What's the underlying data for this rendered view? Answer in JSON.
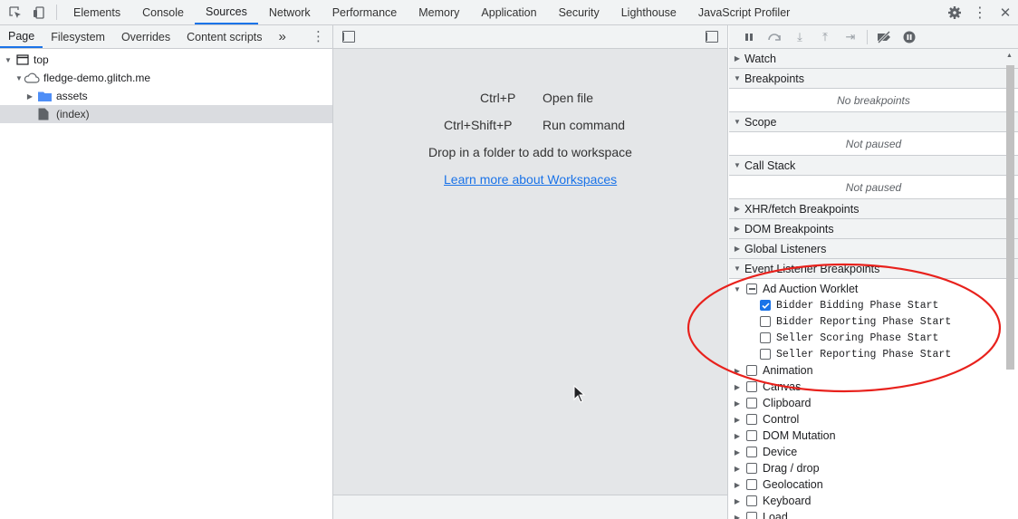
{
  "tabs": [
    "Elements",
    "Console",
    "Sources",
    "Network",
    "Performance",
    "Memory",
    "Application",
    "Security",
    "Lighthouse",
    "JavaScript Profiler"
  ],
  "active_tab": "Sources",
  "navigator": {
    "tabs": [
      "Page",
      "Filesystem",
      "Overrides",
      "Content scripts"
    ],
    "more": "»",
    "tree": {
      "top": "top",
      "domain": "fledge-demo.glitch.me",
      "folder": "assets",
      "file": "(index)"
    }
  },
  "editor": {
    "shortcut1_keys": "Ctrl+P",
    "shortcut1_action": "Open file",
    "shortcut2_keys": "Ctrl+Shift+P",
    "shortcut2_action": "Run command",
    "drop_hint": "Drop in a folder to add to workspace",
    "learn_link": "Learn more about Workspaces"
  },
  "debugger": {
    "watch": "Watch",
    "breakpoints": "Breakpoints",
    "no_breakpoints": "No breakpoints",
    "scope": "Scope",
    "scope_status": "Not paused",
    "call_stack": "Call Stack",
    "call_stack_status": "Not paused",
    "xhr": "XHR/fetch Breakpoints",
    "dom": "DOM Breakpoints",
    "global": "Global Listeners",
    "event": "Event Listener Breakpoints",
    "ad_auction": "Ad Auction Worklet",
    "worklet_items": [
      {
        "label": "Bidder Bidding Phase Start",
        "checked": true
      },
      {
        "label": "Bidder Reporting Phase Start",
        "checked": false
      },
      {
        "label": "Seller Scoring Phase Start",
        "checked": false
      },
      {
        "label": "Seller Reporting Phase Start",
        "checked": false
      }
    ],
    "categories": [
      "Animation",
      "Canvas",
      "Clipboard",
      "Control",
      "DOM Mutation",
      "Device",
      "Drag / drop",
      "Geolocation",
      "Keyboard",
      "Load"
    ]
  },
  "colors": {
    "accent": "#1a73e8",
    "annotation": "#e8211c",
    "panel_bg": "#f1f3f4",
    "editor_bg": "#e4e6e8"
  }
}
